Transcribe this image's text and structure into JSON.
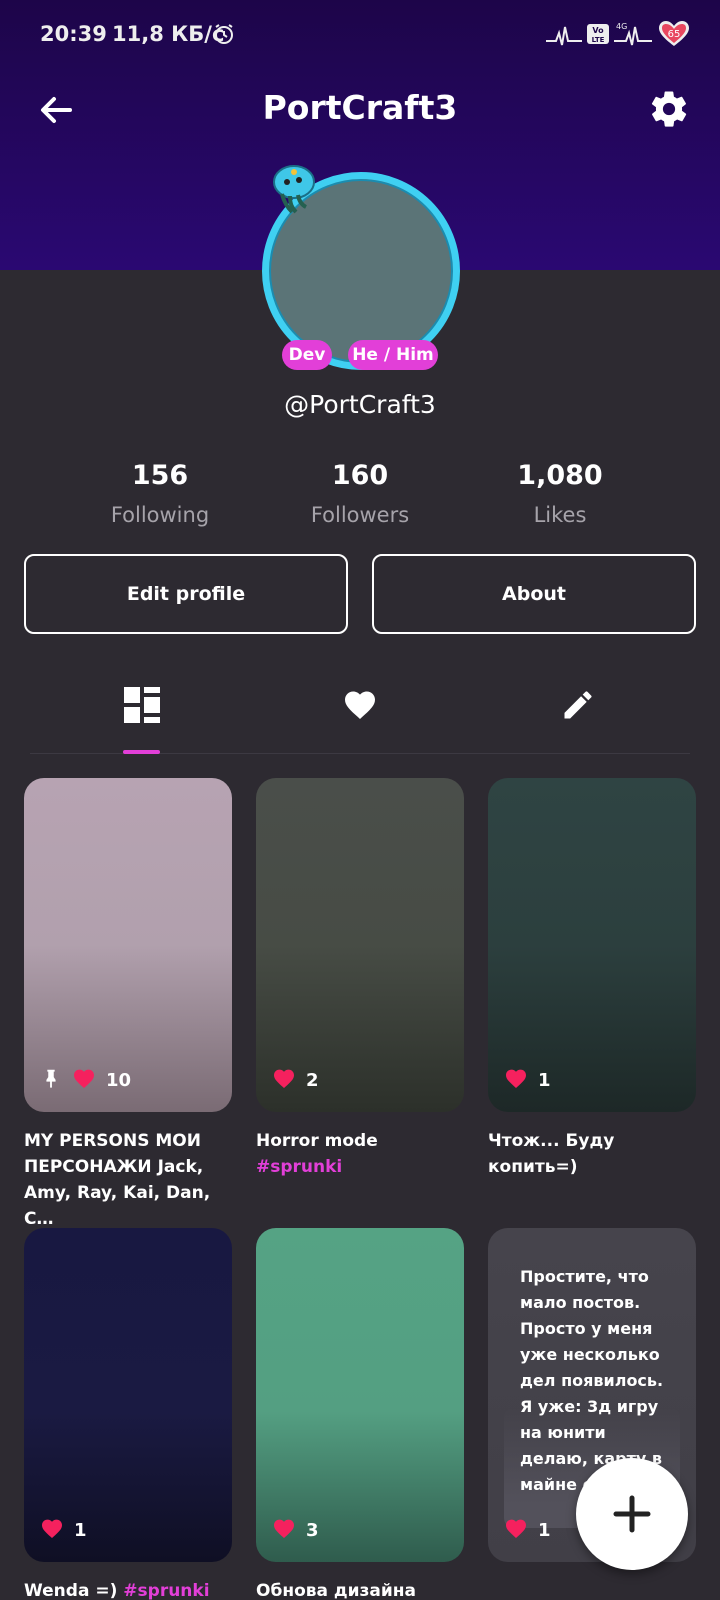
{
  "status_bar": {
    "time": "20:39",
    "speed": "11,8 КБ/с",
    "battery_level": "65"
  },
  "header": {
    "title": "PortCraft3"
  },
  "profile": {
    "tags": [
      "Dev",
      "He / Him"
    ],
    "handle": "@PortCraft3",
    "stats": [
      {
        "value": "156",
        "label": "Following"
      },
      {
        "value": "160",
        "label": "Followers"
      },
      {
        "value": "1,080",
        "label": "Likes"
      }
    ],
    "edit_label": "Edit profile",
    "about_label": "About"
  },
  "tabs": [
    "grid-icon",
    "heart-icon",
    "pencil-icon"
  ],
  "posts": [
    {
      "likes": "10",
      "caption": "MY PERSONS МОИ ПЕРСОНАЖИ Jack, Amy, Ray, Kai, Dan, C…",
      "color_top": "#b7a3b2",
      "color_bottom": "#7a6b74",
      "pinned": true
    },
    {
      "likes": "2",
      "caption_text": "Horror mode ",
      "caption_tag": "#sprunki",
      "color_top": "#4a4e4a",
      "color_bottom": "#2c302a"
    },
    {
      "likes": "1",
      "caption": "Чтож... Буду копить=)",
      "color_top": "#2f4443",
      "color_bottom": "#1d2827"
    },
    {
      "likes": "1",
      "caption_text": "Wenda =) ",
      "caption_tag": "#sprunki",
      "color_top": "#181841",
      "color_bottom": "#0f0f24"
    },
    {
      "likes": "3",
      "caption": "Обнова дизайна",
      "color_top": "#55a384",
      "color_bottom": "#2f5c4d"
    },
    {
      "likes": "1",
      "note": "Простите, что мало постов. Просто у меня уже несколько дел появилось. Я уже: 3д игру на юнити делаю, карту в майне с",
      "color_top": "#46444c",
      "color_bottom": "#3a3840"
    }
  ],
  "colors": {
    "accent": "#e23fd8",
    "heart": "#f5215e",
    "header": "#2a0872",
    "background": "#2d2a31"
  }
}
